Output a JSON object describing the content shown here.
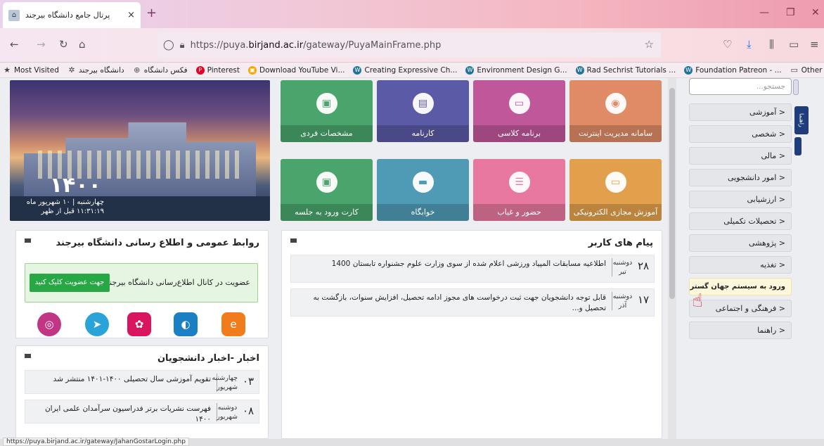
{
  "browser": {
    "tab_title": "پرتال جامع دانشگاه بیرجند",
    "tab_close": "×",
    "new_tab": "+",
    "url_prefix": "https://puya.",
    "url_host": "birjand.ac.ir",
    "url_path": "/gateway/PuyaMainFrame.php",
    "status_url": "https://puya.birjand.ac.ir/gateway/JahanGostarLogin.php"
  },
  "bookmarks": [
    {
      "label": "Most Visited",
      "icon": "star-icon",
      "color": "#444444"
    },
    {
      "label": "دانشگاه بیرجند",
      "icon": "gear-icon",
      "color": "#444444"
    },
    {
      "label": "فکس دانشگاه",
      "icon": "globe-icon",
      "color": "#555555"
    },
    {
      "label": "Pinterest",
      "icon": "pinterest-icon",
      "color": "#e60023"
    },
    {
      "label": "Download YouTube Vi...",
      "icon": "download-icon",
      "color": "#f2a900"
    },
    {
      "label": "Creating Expressive Ch...",
      "icon": "wordpress-icon",
      "color": "#21759b"
    },
    {
      "label": "Environment Design G...",
      "icon": "wordpress-icon",
      "color": "#21759b"
    },
    {
      "label": "Rad Sechrist Tutorials ...",
      "icon": "wordpress-icon",
      "color": "#21759b"
    },
    {
      "label": "Foundation Patreon - ...",
      "icon": "wordpress-icon",
      "color": "#21759b"
    },
    {
      "label": "Other Bookmarks",
      "icon": "folder-icon",
      "color": "#444444"
    }
  ],
  "hero": {
    "year": "۱۴۰۰",
    "date": "چهارشنبه | ۱۰ شهریور ماه",
    "time": "۱۱:۳۱:۱۹ قبل از ظهر"
  },
  "tiles": [
    {
      "label": "سامانه مدیریت اینترنت",
      "icon": "globe-icon",
      "color": "#e08a66",
      "glyph": "◉"
    },
    {
      "label": "برنامه کلاسی",
      "icon": "archive-icon",
      "color": "#c0579a",
      "glyph": "▭"
    },
    {
      "label": "کارنامه",
      "icon": "document-icon",
      "color": "#5b5aa6",
      "glyph": "▤"
    },
    {
      "label": "مشخصات فردی",
      "icon": "id-card-icon",
      "color": "#4aa56c",
      "glyph": "▣"
    },
    {
      "label": "آموزش مجازی الکترونیکی",
      "icon": "monitor-icon",
      "color": "#e3a04c",
      "glyph": "▭"
    },
    {
      "label": "حضور و غیاب",
      "icon": "checklist-icon",
      "color": "#e8789f",
      "glyph": "☰"
    },
    {
      "label": "خوابگاه",
      "icon": "bed-icon",
      "color": "#4f9bb6",
      "glyph": "▬"
    },
    {
      "label": "کارت ورود به جلسه",
      "icon": "badge-icon",
      "color": "#4aa56c",
      "glyph": "▣"
    }
  ],
  "messages": {
    "title": "پیام های کاربر",
    "items": [
      {
        "day_num": "۲۸",
        "day": "دوشنبه",
        "month": "تیر",
        "text": "اطلاعیه مسابقات المپیاد ورزشی اعلام شده از سوی وزارت علوم جشنواره تابستان 1400"
      },
      {
        "day_num": "۱۷",
        "day": "دوشنبه",
        "month": "آذر",
        "text": "قابل توجه دانشجویان جهت ثبت درخواست های مجوز ادامه تحصیل، افزایش سنوات، بازگشت به تحصیل و..."
      }
    ]
  },
  "public_relations": {
    "title": "روابط عمومی و اطلاع رسانی دانشگاه بیرجند",
    "join_text": "عضویت در کانال اطلاع‌رسانی دانشگاه بیرجند",
    "join_button": "جهت عضویت کلیک کنید",
    "socials": [
      {
        "icon": "eitaa-icon",
        "color": "#f07c1b",
        "glyph": "e"
      },
      {
        "icon": "soroush-icon",
        "color": "#1b7fc4",
        "glyph": "◐"
      },
      {
        "icon": "aparat-icon",
        "color": "#d9155f",
        "glyph": "✿"
      },
      {
        "icon": "telegram-icon",
        "color": "#2aa4d8",
        "glyph": "➤"
      },
      {
        "icon": "instagram-icon",
        "color": "#c13584",
        "glyph": "◎"
      }
    ]
  },
  "news": {
    "title": "اخبار -اخبار دانشجویان",
    "items": [
      {
        "day_num": "۰۳",
        "day": "چهارشنبه",
        "month": "شهریور",
        "text": "تقویم آموزشی سال تحصیلی ۱۴۰۰-۱۴۰۱ منتشر شد"
      },
      {
        "day_num": "۰۸",
        "day": "دوشنبه",
        "month": "شهریور",
        "text": "فهرست نشریات برتر فدراسیون سرآمدان علمی ایران ۱۴۰۰"
      }
    ]
  },
  "sidebar": {
    "search_placeholder": "جستجو...",
    "vertical_tab": "راهنما",
    "items": [
      {
        "label": "آموزشی"
      },
      {
        "label": "شخصی"
      },
      {
        "label": "مالی"
      },
      {
        "label": "امور دانشجویی"
      },
      {
        "label": "ارزشیابی"
      },
      {
        "label": "تحصیلات تکمیلی"
      },
      {
        "label": "پژوهشی"
      },
      {
        "label": "تغذیه"
      },
      {
        "label": "ورود به سیستم جهان گستر"
      },
      {
        "label": "فرهنگی و اجتماعی"
      },
      {
        "label": "راهنما"
      }
    ],
    "chevron": "<"
  }
}
